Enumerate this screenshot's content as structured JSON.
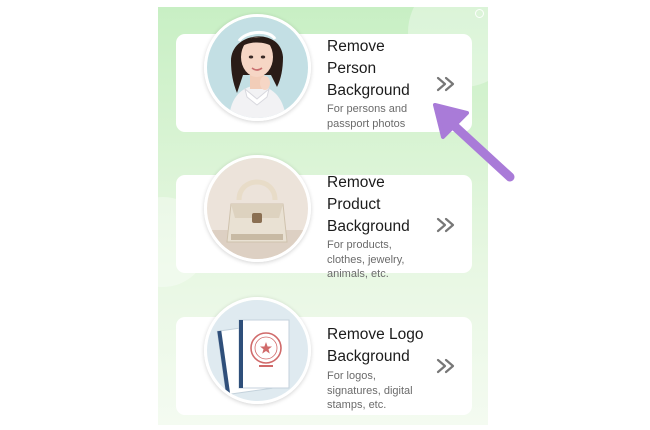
{
  "options": [
    {
      "title": "Remove Person Background",
      "description": "For persons and passport photos",
      "thumbnail_icon": "person-photo-icon",
      "action_icon": "double-chevron-right-icon"
    },
    {
      "title": "Remove Product Background",
      "description": "For products, clothes, jewelry, animals, etc.",
      "thumbnail_icon": "handbag-photo-icon",
      "action_icon": "double-chevron-right-icon"
    },
    {
      "title": "Remove Logo Background",
      "description": "For logos, signatures, digital stamps, etc.",
      "thumbnail_icon": "document-stamp-icon",
      "action_icon": "double-chevron-right-icon"
    }
  ],
  "annotation_icon": "purple-pointer-arrow-icon",
  "colors": {
    "background_top": "#c8efc4",
    "background_bottom": "#f4fbf1",
    "chevron": "#777777",
    "annotation_arrow": "#a97bd8"
  }
}
